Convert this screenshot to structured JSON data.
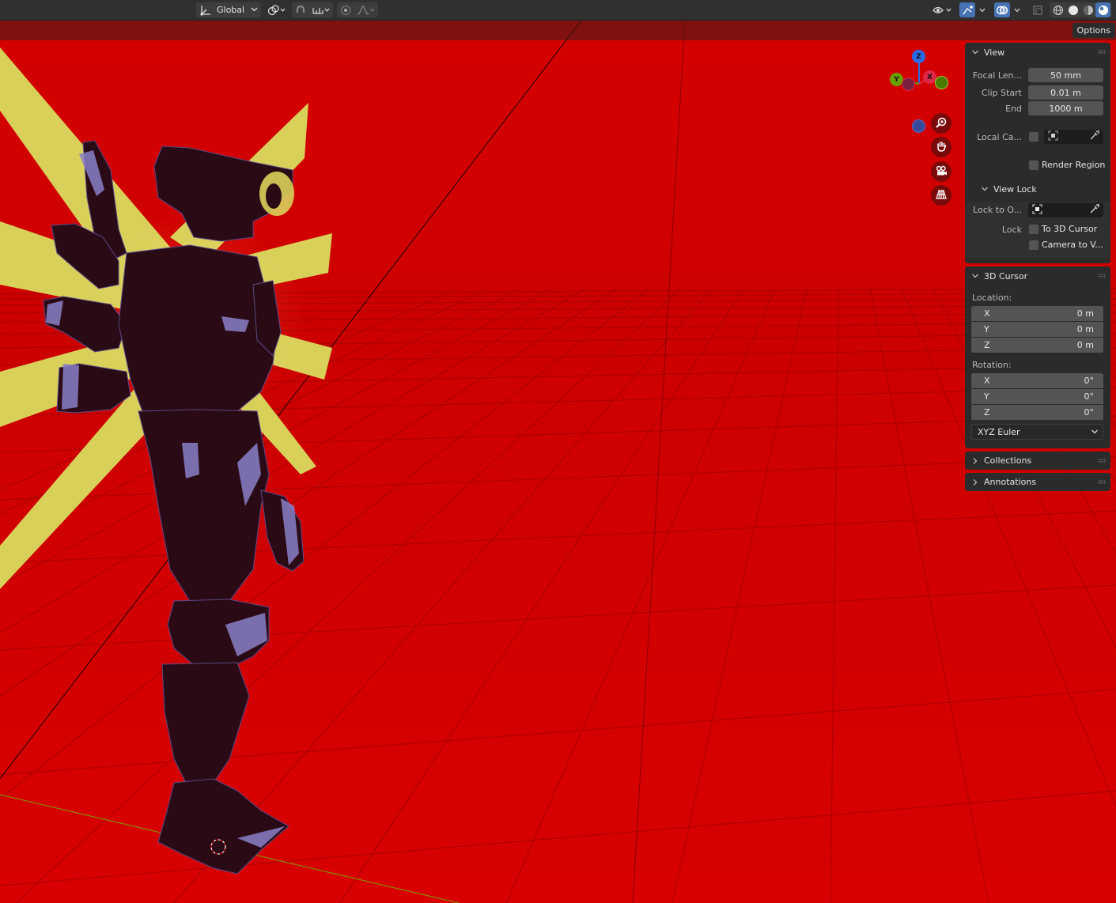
{
  "header": {
    "orientation": {
      "label": "Global",
      "icon": "transform-orientation-icon"
    },
    "pivot_icon": "pivot-point-icon",
    "snap_icon": "snap-magnet-icon",
    "snap_target_icon": "snap-increment-icon",
    "proportional_icon": "proportional-editing-icon",
    "falloff_icon": "falloff-curve-icon",
    "visibility_icon": "eye-icon",
    "gizmo_icon": "gizmo-toggle-icon",
    "overlay_icon": "overlays-icon",
    "xray_icon": "xray-icon",
    "shading_modes": [
      "wireframe",
      "solid",
      "material-preview",
      "rendered"
    ]
  },
  "viewport": {
    "options_label": "Options",
    "gizmo": {
      "z": "Z",
      "y": "Y",
      "x": "X"
    },
    "nav_icons": [
      "zoom-icon",
      "hand-pan-icon",
      "camera-icon",
      "perspective-grid-icon"
    ],
    "colors": {
      "background": "#d40000",
      "grid": "#a80000",
      "accent_yellow": "#d9d05a",
      "robot": "#2a0a14"
    }
  },
  "npanel": {
    "view": {
      "title": "View",
      "focal_length": {
        "label": "Focal Len...",
        "value": "50 mm"
      },
      "clip_start": {
        "label": "Clip Start",
        "value": "0.01 m"
      },
      "clip_end": {
        "label": "End",
        "value": "1000 m"
      },
      "local_camera": {
        "label": "Local Ca..."
      },
      "render_region": {
        "label": "Render Region"
      },
      "view_lock": {
        "title": "View Lock",
        "lock_to_object": {
          "label": "Lock to O..."
        },
        "lock_label": "Lock",
        "to_3d_cursor": "To 3D Cursor",
        "camera_to_view": "Camera to V..."
      }
    },
    "cursor": {
      "title": "3D Cursor",
      "location_label": "Location:",
      "location": [
        {
          "axis": "X",
          "value": "0 m"
        },
        {
          "axis": "Y",
          "value": "0 m"
        },
        {
          "axis": "Z",
          "value": "0 m"
        }
      ],
      "rotation_label": "Rotation:",
      "rotation": [
        {
          "axis": "X",
          "value": "0°"
        },
        {
          "axis": "Y",
          "value": "0°"
        },
        {
          "axis": "Z",
          "value": "0°"
        }
      ],
      "rotation_mode": "XYZ Euler"
    },
    "collections": {
      "title": "Collections"
    },
    "annotations": {
      "title": "Annotations"
    }
  }
}
